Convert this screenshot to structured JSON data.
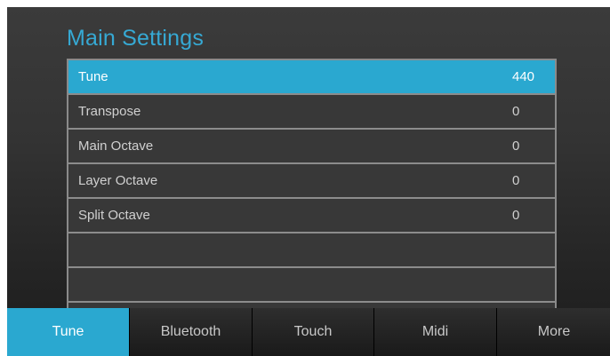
{
  "page": {
    "title": "Main Settings"
  },
  "settings": {
    "rows": [
      {
        "label": "Tune",
        "value": "440",
        "selected": true
      },
      {
        "label": "Transpose",
        "value": "0",
        "selected": false
      },
      {
        "label": "Main Octave",
        "value": "0",
        "selected": false
      },
      {
        "label": "Layer Octave",
        "value": "0",
        "selected": false
      },
      {
        "label": "Split Octave",
        "value": "0",
        "selected": false
      },
      {
        "label": "",
        "value": "",
        "selected": false
      },
      {
        "label": "",
        "value": "",
        "selected": false
      }
    ]
  },
  "tabs": [
    {
      "label": "Tune",
      "active": true
    },
    {
      "label": "Bluetooth",
      "active": false
    },
    {
      "label": "Touch",
      "active": false
    },
    {
      "label": "Midi",
      "active": false
    },
    {
      "label": "More",
      "active": false
    }
  ],
  "colors": {
    "accent": "#2aa8d0",
    "title": "#36a9d4",
    "row_background": "#383838",
    "row_divider": "#8c8c8c"
  }
}
